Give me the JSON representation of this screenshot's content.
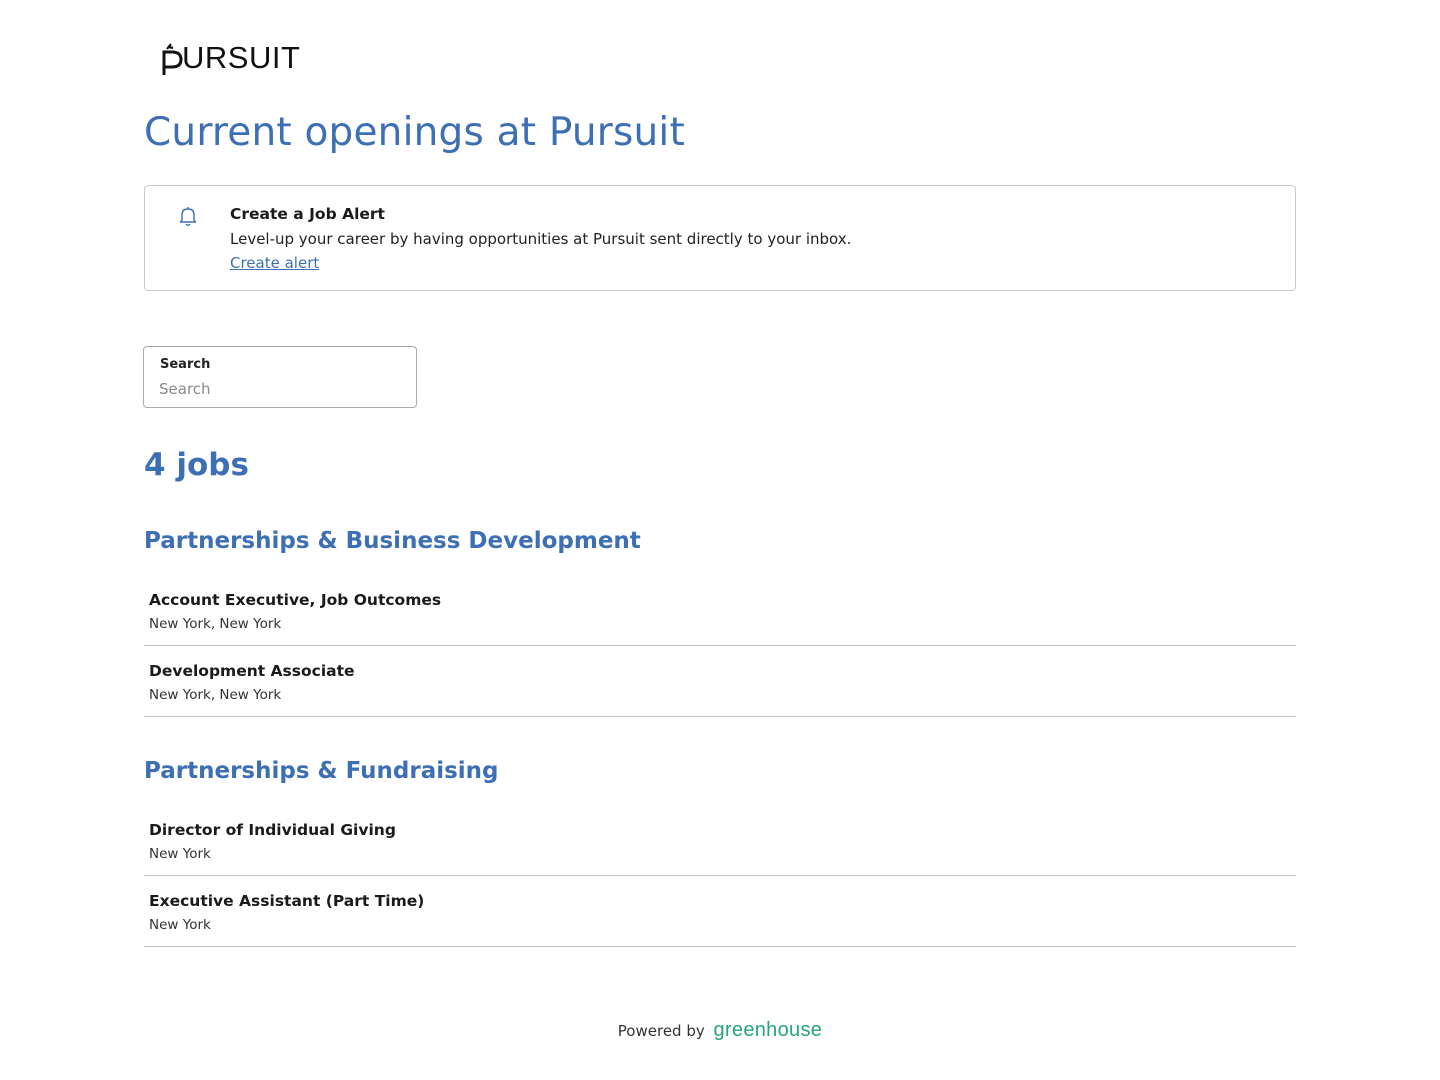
{
  "logo": {
    "text": "URSUIT",
    "brand": "Pursuit"
  },
  "page_title": "Current openings at Pursuit",
  "alert": {
    "icon": "bell-icon",
    "title": "Create a Job Alert",
    "description": "Level-up your career by having opportunities at Pursuit sent directly to your inbox.",
    "link_label": "Create alert"
  },
  "search": {
    "label": "Search",
    "placeholder": "Search",
    "value": ""
  },
  "jobs_count": "4 jobs",
  "departments": [
    {
      "name": "Partnerships & Business Development",
      "jobs": [
        {
          "title": "Account Executive, Job Outcomes",
          "location": "New York, New York"
        },
        {
          "title": "Development Associate",
          "location": "New York, New York"
        }
      ]
    },
    {
      "name": "Partnerships & Fundraising",
      "jobs": [
        {
          "title": "Director of Individual Giving",
          "location": "New York"
        },
        {
          "title": "Executive Assistant (Part Time)",
          "location": "New York"
        }
      ]
    }
  ],
  "footer": {
    "powered_by": "Powered by",
    "brand": "greenhouse"
  },
  "colors": {
    "accent": "#3d6fb4",
    "greenhouse": "#24a47f",
    "border": "#c4c4c4"
  }
}
